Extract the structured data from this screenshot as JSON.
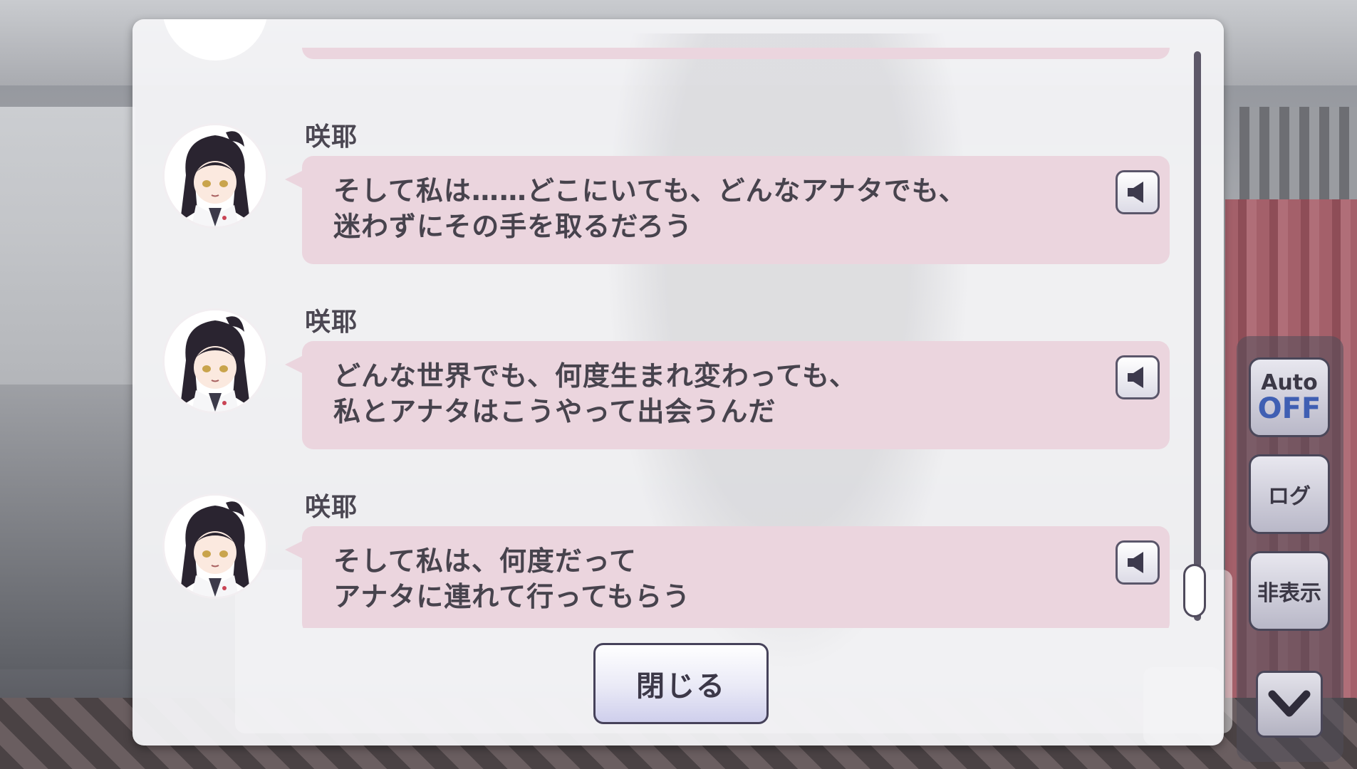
{
  "log": {
    "entries": [
      {
        "speaker": "咲耶",
        "text": "そして私は……どこにいても、どんなアナタでも、\n迷わずにその手を取るだろう"
      },
      {
        "speaker": "咲耶",
        "text": "どんな世界でも、何度生まれ変わっても、\n私とアナタはこうやって出会うんだ"
      },
      {
        "speaker": "咲耶",
        "text": "そして私は、何度だって\nアナタに連れて行ってもらう"
      }
    ],
    "close_label": "閉じる",
    "scroll_position": 1.0
  },
  "side_menu": {
    "auto_label": "Auto",
    "auto_state": "OFF",
    "log_label": "ログ",
    "hide_label": "非表示",
    "down_icon": "chevron-down-icon"
  },
  "colors": {
    "bubble": "#ebd5de",
    "panel": "#f4f4f6",
    "auto_state": "#3f5fb3",
    "outline": "#4a4759"
  }
}
